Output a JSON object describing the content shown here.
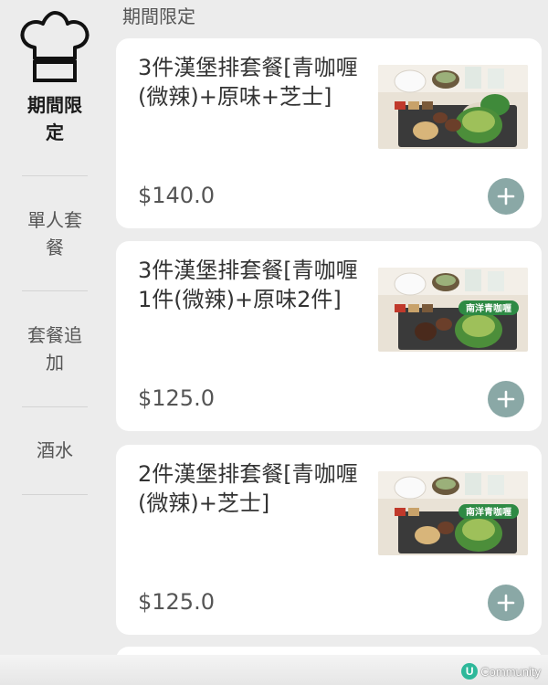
{
  "sidebar": {
    "items": [
      {
        "label": "期間限定",
        "icon": "chef-hat-icon",
        "active": true
      },
      {
        "label": "單人套餐",
        "active": false
      },
      {
        "label": "套餐追加",
        "active": false
      },
      {
        "label": "酒水",
        "active": false
      }
    ]
  },
  "section": {
    "label": "期間限定"
  },
  "menu_items": [
    {
      "title": "3件漢堡排套餐[青咖喱(微辣)+原味+芝士]",
      "price": "$140.0",
      "image_badge": ""
    },
    {
      "title": "3件漢堡排套餐[青咖喱1件(微辣)+原味2件]",
      "price": "$125.0",
      "image_badge": "南洋青咖喱"
    },
    {
      "title": "2件漢堡排套餐[青咖喱(微辣)+芝士]",
      "price": "$125.0",
      "image_badge": "南洋青咖喱"
    }
  ],
  "add_button": {
    "icon": "plus-icon"
  },
  "watermark": {
    "text": "Community",
    "logo": "U"
  },
  "colors": {
    "accent": "#8aa8a6",
    "card_bg": "#ffffff",
    "page_bg": "#ececec",
    "watermark_green": "#2eb89a"
  }
}
